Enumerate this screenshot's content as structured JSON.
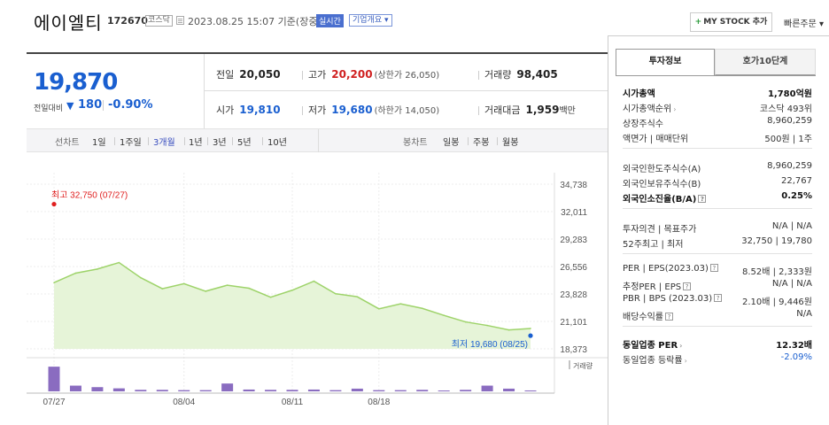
{
  "header": {
    "company_name": "에이엘티",
    "code": "172670",
    "market_badge": "코스닥",
    "datetime": "2023.08.25 15:07 기준(장중)",
    "realtime_badge": "실시간",
    "company_info_badge": "기업개요",
    "company_info_arrow": "▾",
    "mystock_plus": "+",
    "mystock_label": "MY STOCK 추가",
    "quick_order": "빠른주문",
    "quick_order_arrow": "▾"
  },
  "price": {
    "current": "19,870",
    "change_label": "전일대비",
    "change_icon": "▼",
    "change_value": "180",
    "change_pct": "-0.90%"
  },
  "stats": {
    "prev_label": "전일",
    "prev_value": "20,050",
    "high_label": "고가",
    "high_value": "20,200",
    "high_sub": "(상한가 26,050)",
    "volume_label": "거래량",
    "volume_value": "98,405",
    "open_label": "시가",
    "open_value": "19,810",
    "low_label": "저가",
    "low_value": "19,680",
    "low_sub": "(하한가 14,050)",
    "amount_label": "거래대금",
    "amount_value": "1,959",
    "amount_unit": "백만"
  },
  "period_bar": {
    "line_chart_label": "선차트",
    "line_periods": [
      "1일",
      "1주일",
      "3개월",
      "1년",
      "3년",
      "5년",
      "10년"
    ],
    "active_period": "3개월",
    "candle_chart_label": "봉차트",
    "candle_periods": [
      "일봉",
      "주봉",
      "월봉"
    ]
  },
  "chart_data": {
    "type": "area",
    "series": [
      {
        "values": [
          24950,
          25900,
          26300,
          26950,
          25450,
          24350,
          24850,
          24100,
          24700,
          24400,
          23500,
          24200,
          25100,
          23850,
          23550,
          22350,
          22850,
          22400,
          21700,
          21050,
          20700,
          20250,
          20400
        ]
      }
    ],
    "volume": [
      0.82,
      0.19,
      0.14,
      0.1,
      0.05,
      0.05,
      0.04,
      0.04,
      0.26,
      0.06,
      0.05,
      0.05,
      0.06,
      0.04,
      0.09,
      0.04,
      0.04,
      0.05,
      0.02,
      0.05,
      0.19,
      0.09,
      0.03
    ],
    "x_tick_labels": [
      "07/27",
      "08/04",
      "08/11",
      "08/18"
    ],
    "x_tick_index": [
      0,
      6,
      11,
      15
    ],
    "y_ticks": [
      34738,
      32011,
      29283,
      26556,
      23828,
      21101,
      18373
    ],
    "y_tick_labels": [
      "34,738",
      "32,011",
      "29,283",
      "26,556",
      "23,828",
      "21,101",
      "18,373"
    ],
    "ylim": [
      18373,
      34738
    ],
    "max_label": "최고 32,750 (07/27)",
    "max_value": 32750,
    "min_label": "최저 19,680 (08/25)",
    "min_value": 19680,
    "volume_label": "거래량",
    "line_color": "#9ed36a",
    "fill_color": "#e6f4d8",
    "volume_color": "#8a6cc0",
    "max_marker_color": "#e02020",
    "min_marker_color": "#1a5fd0"
  },
  "panel": {
    "tab_active": "투자정보",
    "tab_other": "호가10단계",
    "rows_a": [
      {
        "k": "시가총액",
        "v": "1,780억원",
        "bold": true
      },
      {
        "k": "시가총액순위",
        "v": "코스닥 493위",
        "arrow": true
      },
      {
        "k": "상장주식수",
        "v": "8,960,259"
      },
      {
        "k": "액면가 | 매매단위",
        "v": "500원 | 1주"
      }
    ],
    "rows_b": [
      {
        "k": "외국인한도주식수(A)",
        "v": "8,960,259"
      },
      {
        "k": "외국인보유주식수(B)",
        "v": "22,767"
      },
      {
        "k": "외국인소진율(B/A)",
        "v": "0.25%",
        "bold": true,
        "q": true
      }
    ],
    "rows_c": [
      {
        "k": "투자의견 | 목표주가",
        "v": "N/A | N/A"
      },
      {
        "k": "52주최고 | 최저",
        "v": "32,750 | 19,780"
      }
    ],
    "rows_d": [
      {
        "k": "PER | EPS(2023.03)",
        "v": "8.52배 | 2,333원",
        "q": true
      },
      {
        "k": "추정PER | EPS",
        "v": "N/A | N/A",
        "q": true
      },
      {
        "k": "PBR | BPS (2023.03)",
        "v": "2.10배 | 9,446원",
        "q": true
      },
      {
        "k": "배당수익률",
        "v": "N/A",
        "q": true
      }
    ],
    "rows_e": [
      {
        "k": "동일업종 PER",
        "v": "12.32배",
        "bold": true,
        "arrow": true
      },
      {
        "k": "동일업종 등락률",
        "v": "-2.09%",
        "arrow": true,
        "blue": true
      }
    ],
    "q_glyph": "?",
    "arrow_glyph": "›"
  }
}
